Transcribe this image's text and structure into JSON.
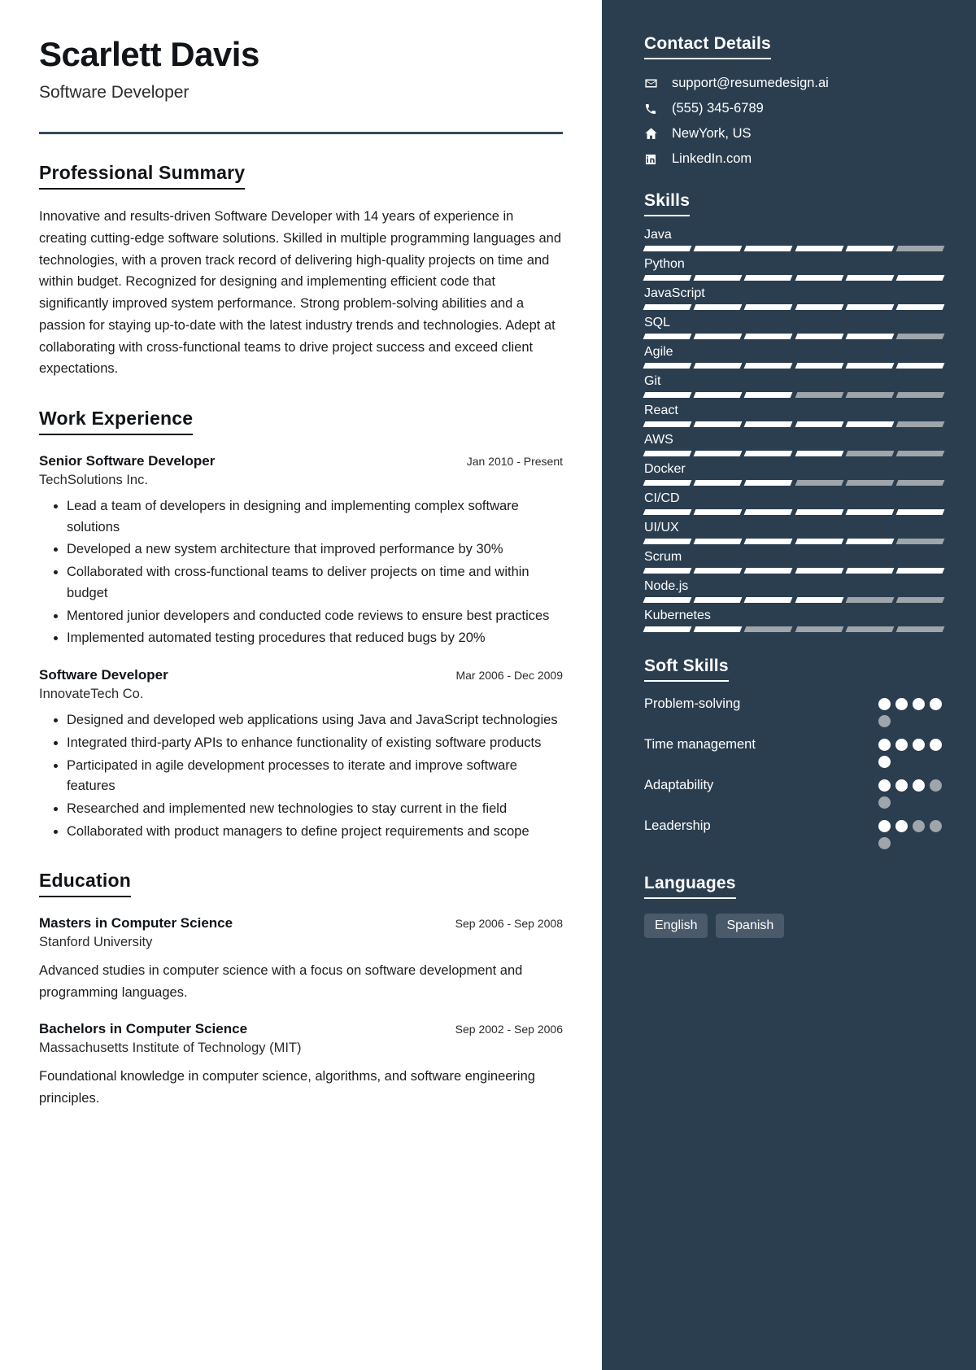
{
  "header": {
    "name": "Scarlett Davis",
    "title": "Software Developer"
  },
  "sections": {
    "summary_title": "Professional Summary",
    "summary_text": "Innovative and results-driven Software Developer with 14 years of experience in creating cutting-edge software solutions. Skilled in multiple programming languages and technologies, with a proven track record of delivering high-quality projects on time and within budget. Recognized for designing and implementing efficient code that significantly improved system performance. Strong problem-solving abilities and a passion for staying up-to-date with the latest industry trends and technologies. Adept at collaborating with cross-functional teams to drive project success and exceed client expectations.",
    "work_title": "Work Experience",
    "education_title": "Education"
  },
  "work_experience": [
    {
      "role": "Senior Software Developer",
      "date": "Jan 2010 - Present",
      "company": "TechSolutions Inc.",
      "bullets": [
        "Lead a team of developers in designing and implementing complex software solutions",
        "Developed a new system architecture that improved performance by 30%",
        "Collaborated with cross-functional teams to deliver projects on time and within budget",
        "Mentored junior developers and conducted code reviews to ensure best practices",
        "Implemented automated testing procedures that reduced bugs by 20%"
      ]
    },
    {
      "role": "Software Developer",
      "date": "Mar 2006 - Dec 2009",
      "company": "InnovateTech Co.",
      "bullets": [
        "Designed and developed web applications using Java and JavaScript technologies",
        "Integrated third-party APIs to enhance functionality of existing software products",
        "Participated in agile development processes to iterate and improve software features",
        "Researched and implemented new technologies to stay current in the field",
        "Collaborated with product managers to define project requirements and scope"
      ]
    }
  ],
  "education": [
    {
      "degree": "Masters in Computer Science",
      "date": "Sep 2006 - Sep 2008",
      "school": "Stanford University",
      "description": "Advanced studies in computer science with a focus on software development and programming languages."
    },
    {
      "degree": "Bachelors in Computer Science",
      "date": "Sep 2002 - Sep 2006",
      "school": "Massachusetts Institute of Technology (MIT)",
      "description": "Foundational knowledge in computer science, algorithms, and software engineering principles."
    }
  ],
  "sidebar": {
    "contact_title": "Contact Details",
    "contacts": [
      {
        "icon": "envelope-icon",
        "text": "support@resumedesign.ai"
      },
      {
        "icon": "phone-icon",
        "text": "(555) 345-6789"
      },
      {
        "icon": "home-icon",
        "text": "NewYork, US"
      },
      {
        "icon": "linkedin-icon",
        "text": "LinkedIn.com"
      }
    ],
    "skills_title": "Skills",
    "skills_segments": 6,
    "skills": [
      {
        "name": "Java",
        "filled": 5
      },
      {
        "name": "Python",
        "filled": 6
      },
      {
        "name": "JavaScript",
        "filled": 6
      },
      {
        "name": "SQL",
        "filled": 5
      },
      {
        "name": "Agile",
        "filled": 6
      },
      {
        "name": "Git",
        "filled": 3
      },
      {
        "name": "React",
        "filled": 5
      },
      {
        "name": "AWS",
        "filled": 4
      },
      {
        "name": "Docker",
        "filled": 3
      },
      {
        "name": "CI/CD",
        "filled": 6
      },
      {
        "name": "UI/UX",
        "filled": 5
      },
      {
        "name": "Scrum",
        "filled": 6
      },
      {
        "name": "Node.js",
        "filled": 4
      },
      {
        "name": "Kubernetes",
        "filled": 2
      }
    ],
    "soft_skills_title": "Soft Skills",
    "soft_dots_total": 5,
    "soft_skills": [
      {
        "name": "Problem-solving",
        "filled": 4
      },
      {
        "name": "Time management",
        "filled": 5
      },
      {
        "name": "Adaptability",
        "filled": 3
      },
      {
        "name": "Leadership",
        "filled": 2
      }
    ],
    "languages_title": "Languages",
    "languages": [
      "English",
      "Spanish"
    ],
    "colors": {
      "sidebar_bg": "#2b3e50",
      "accent_rule": "#33485c",
      "bar_on": "#ffffff",
      "bar_off": "#9ea5ab",
      "tag_bg": "#4a5a6b"
    }
  }
}
